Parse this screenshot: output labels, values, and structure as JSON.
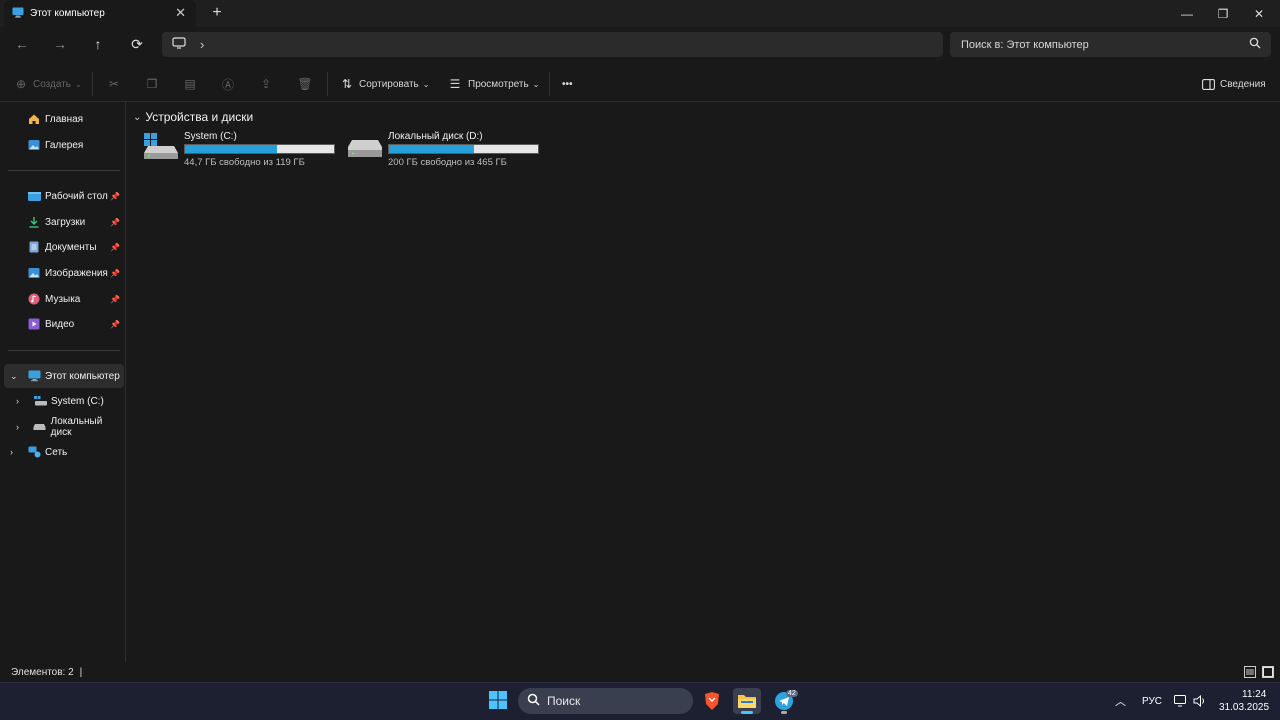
{
  "window": {
    "tab_title": "Этот компьютер",
    "tab_close": "✕",
    "new_tab": "+",
    "minimize": "—",
    "restore": "❐",
    "close": "✕"
  },
  "nav": {
    "back": "←",
    "forward": "→",
    "up": "↑",
    "refresh": "⟳",
    "breadcrumb_sep": "›",
    "search_placeholder": "Поиск в: Этот компьютер"
  },
  "toolbar": {
    "create": "Создать",
    "sort": "Сортировать",
    "view": "Просмотреть",
    "more": "•••",
    "details": "Сведения"
  },
  "sidebar": {
    "top": [
      {
        "label": "Главная",
        "icon": "home-icon"
      },
      {
        "label": "Галерея",
        "icon": "gallery-icon"
      }
    ],
    "pinned": [
      {
        "label": "Рабочий стол",
        "icon": "desktop-icon"
      },
      {
        "label": "Загрузки",
        "icon": "download-icon"
      },
      {
        "label": "Документы",
        "icon": "document-icon"
      },
      {
        "label": "Изображения",
        "icon": "pictures-icon"
      },
      {
        "label": "Музыка",
        "icon": "music-icon"
      },
      {
        "label": "Видео",
        "icon": "video-icon"
      }
    ],
    "tree": [
      {
        "label": "Этот компьютер",
        "icon": "computer-icon"
      },
      {
        "label": "System (C:)",
        "icon": "drive-icon"
      },
      {
        "label": "Локальный диск",
        "icon": "drive-icon"
      },
      {
        "label": "Сеть",
        "icon": "network-icon"
      }
    ]
  },
  "content": {
    "section_title": "Устройства и диски",
    "drives": [
      {
        "name": "System (C:)",
        "usage": "44,7 ГБ свободно из 119 ГБ",
        "used_fraction": 0.62
      },
      {
        "name": "Локальный диск (D:)",
        "usage": "200 ГБ свободно из 465 ГБ",
        "used_fraction": 0.57
      }
    ]
  },
  "status": {
    "items": "Элементов: 2",
    "cursor": "|"
  },
  "taskbar": {
    "search": "Поиск",
    "telegram_badge": "42",
    "lang": "РУС",
    "time": "11:24",
    "date": "31.03.2025"
  },
  "colors": {
    "accent": "#26a0da",
    "background": "#191919",
    "taskbar": "#1c2030"
  }
}
